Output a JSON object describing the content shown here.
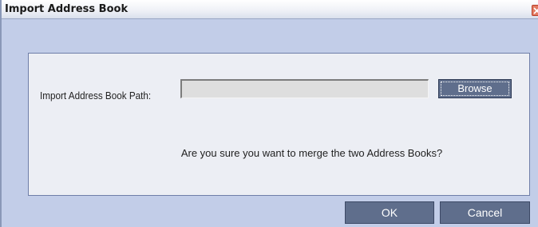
{
  "window": {
    "title": "Import Address Book"
  },
  "form": {
    "path_label": "Import Address Book Path:",
    "path_value": "",
    "browse_label": "Browse",
    "question": "Are you sure you want to merge the two Address Books?"
  },
  "footer": {
    "ok_label": "OK",
    "cancel_label": "Cancel"
  },
  "icons": {
    "close": "close-icon"
  },
  "colors": {
    "window_background": "#c2cde8",
    "panel_background": "#eceef4",
    "button_background": "#5f6e8c",
    "close_button": "#e27a61"
  }
}
